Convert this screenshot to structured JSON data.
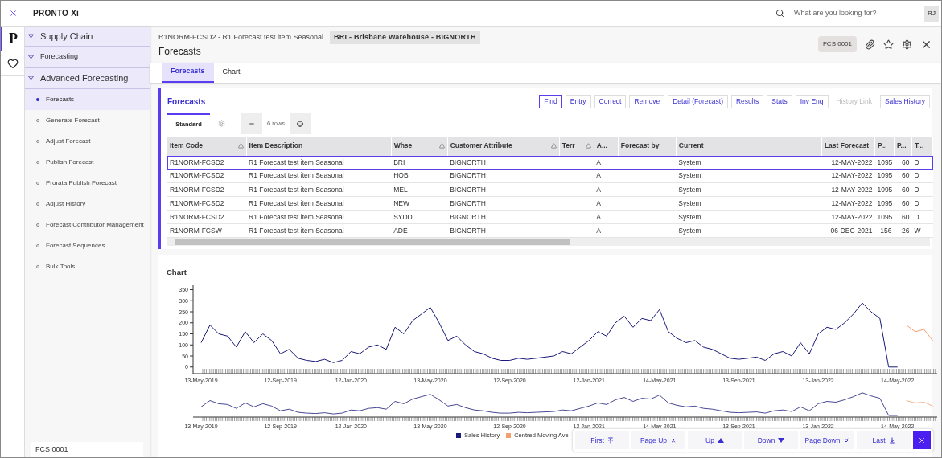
{
  "topbar": {
    "logo": "PRONTO Xi",
    "search": {
      "placeholder": "What are you looking for?"
    },
    "avatar": "RJ"
  },
  "rail": {
    "logo": "P"
  },
  "sidebar": {
    "tree": [
      {
        "label": "Supply Chain",
        "expanded": true,
        "children": [
          {
            "label": "Forecasting",
            "expanded": true,
            "children": [
              {
                "label": "Advanced Forecasting",
                "expanded": true,
                "children": [
                  {
                    "label": "Forecasts",
                    "selected": true
                  },
                  {
                    "label": "Generate Forecast",
                    "selected": false
                  },
                  {
                    "label": "Adjust Forecast",
                    "selected": false
                  },
                  {
                    "label": "Publish Forecast",
                    "selected": false
                  },
                  {
                    "label": "Prorata Publish Forecast",
                    "selected": false
                  },
                  {
                    "label": "Adjust History",
                    "selected": false
                  },
                  {
                    "label": "Forecast Contributor Management",
                    "selected": false
                  },
                  {
                    "label": "Forecast Sequences",
                    "selected": false
                  },
                  {
                    "label": "Bulk Tools",
                    "selected": false
                  }
                ]
              }
            ]
          }
        ]
      }
    ],
    "footer": "FCS 0001"
  },
  "header": {
    "breadcrumb": "R1NORM-FCSD2 - R1 Forecast test item Seasonal",
    "badge": "BRI - Brisbane Warehouse - BIGNORTH",
    "title": "Forecasts",
    "code": "FCS 0001"
  },
  "tabs": [
    {
      "label": "Forecasts",
      "selected": true
    },
    {
      "label": "Chart",
      "selected": false
    }
  ],
  "forecasts": {
    "title": "Forecasts",
    "actions": [
      {
        "label": "Find",
        "focused": true,
        "disabled": false
      },
      {
        "label": "Entry",
        "focused": false,
        "disabled": false
      },
      {
        "label": "Correct",
        "focused": false,
        "disabled": false
      },
      {
        "label": "Remove",
        "focused": false,
        "disabled": false
      },
      {
        "label": "Detail (Forecast)",
        "focused": false,
        "disabled": false
      },
      {
        "label": "Results",
        "focused": false,
        "disabled": false
      },
      {
        "label": "Stats",
        "focused": false,
        "disabled": false
      },
      {
        "label": "Inv Enq",
        "focused": false,
        "disabled": false
      },
      {
        "label": "History Link",
        "focused": false,
        "disabled": true
      },
      {
        "label": "Sales History",
        "focused": false,
        "disabled": false
      }
    ],
    "view": "Standard",
    "row_count": "6 rows",
    "columns": [
      {
        "label": "Item Code",
        "sortable": true
      },
      {
        "label": "Item Description",
        "sortable": false
      },
      {
        "label": "Whse",
        "sortable": true
      },
      {
        "label": "Customer Attribute",
        "sortable": true
      },
      {
        "label": "Terr",
        "sortable": true
      },
      {
        "label": "A...",
        "sortable": false
      },
      {
        "label": "Forecast by",
        "sortable": false
      },
      {
        "label": "Current",
        "sortable": false
      },
      {
        "label": "Last Forecast",
        "sortable": false
      },
      {
        "label": "P...",
        "sortable": false
      },
      {
        "label": "P...",
        "sortable": false
      },
      {
        "label": "T...",
        "sortable": false
      }
    ],
    "rows": [
      {
        "selected": true,
        "cells": [
          "R1NORM-FCSD2",
          "R1 Forecast test item Seasonal",
          "BRI",
          "BIGNORTH",
          "",
          "A",
          "",
          "System",
          "12-MAY-2022",
          "1095",
          "60",
          "D"
        ]
      },
      {
        "selected": false,
        "cells": [
          "R1NORM-FCSD2",
          "R1 Forecast test item Seasonal",
          "HOB",
          "BIGNORTH",
          "",
          "A",
          "",
          "System",
          "12-MAY-2022",
          "1095",
          "60",
          "D"
        ]
      },
      {
        "selected": false,
        "cells": [
          "R1NORM-FCSD2",
          "R1 Forecast test item Seasonal",
          "MEL",
          "BIGNORTH",
          "",
          "A",
          "",
          "System",
          "12-MAY-2022",
          "1095",
          "60",
          "D"
        ]
      },
      {
        "selected": false,
        "cells": [
          "R1NORM-FCSD2",
          "R1 Forecast test item Seasonal",
          "NEW",
          "BIGNORTH",
          "",
          "A",
          "",
          "System",
          "12-MAY-2022",
          "1095",
          "60",
          "D"
        ]
      },
      {
        "selected": false,
        "cells": [
          "R1NORM-FCSD2",
          "R1 Forecast test item Seasonal",
          "SYDD",
          "BIGNORTH",
          "",
          "A",
          "",
          "System",
          "12-MAY-2022",
          "1095",
          "60",
          "D"
        ]
      },
      {
        "selected": false,
        "cells": [
          "R1NORM-FCSW",
          "R1 Forecast test item Seasonal",
          "ADE",
          "BIGNORTH",
          "",
          "A",
          "",
          "System",
          "06-DEC-2021",
          "156",
          "26",
          "W"
        ]
      }
    ]
  },
  "chart": {
    "title": "Chart",
    "chart_data": {
      "type": "line",
      "ylim": [
        -30,
        370
      ],
      "legend": true,
      "yticks": [
        0,
        50,
        100,
        150,
        200,
        250,
        300,
        350
      ],
      "categories": [
        "13-May-2019",
        null,
        null,
        null,
        null,
        null,
        null,
        null,
        null,
        "12-Sep-2019",
        null,
        null,
        null,
        null,
        null,
        null,
        null,
        "12-Jan-2020",
        null,
        null,
        null,
        null,
        null,
        null,
        null,
        null,
        "13-May-2020",
        null,
        null,
        null,
        null,
        null,
        null,
        null,
        null,
        "12-Sep-2020",
        null,
        null,
        null,
        null,
        null,
        null,
        null,
        null,
        "12-Jan-2021",
        null,
        null,
        null,
        null,
        null,
        null,
        null,
        "14-May-2021",
        null,
        null,
        null,
        null,
        null,
        null,
        null,
        null,
        "13-Sep-2021",
        null,
        null,
        null,
        null,
        null,
        null,
        null,
        null,
        "13-Jan-2022",
        null,
        null,
        null,
        null,
        null,
        null,
        null,
        null,
        "14-May-2022",
        null,
        null,
        null,
        null
      ],
      "series": [
        {
          "name": "Sales History",
          "color": "#1a1a7a",
          "values": [
            110,
            190,
            150,
            140,
            90,
            160,
            110,
            150,
            120,
            60,
            80,
            40,
            30,
            25,
            35,
            20,
            30,
            70,
            60,
            90,
            100,
            80,
            180,
            150,
            210,
            240,
            270,
            200,
            120,
            140,
            100,
            70,
            60,
            40,
            30,
            30,
            40,
            35,
            40,
            45,
            50,
            70,
            60,
            90,
            120,
            160,
            140,
            200,
            230,
            180,
            220,
            210,
            260,
            160,
            130,
            110,
            120,
            90,
            80,
            60,
            40,
            35,
            40,
            45,
            30,
            60,
            70,
            50,
            110,
            60,
            150,
            180,
            170,
            200,
            240,
            290,
            250,
            220,
            0,
            0,
            null,
            null,
            null,
            null
          ]
        },
        {
          "name": "Centred Moving Ave",
          "color": "#f4a070",
          "values": [
            null,
            null,
            null,
            null,
            null,
            null,
            null,
            null,
            null,
            null,
            null,
            null,
            null,
            null,
            null,
            null,
            null,
            null,
            null,
            null,
            null,
            null,
            null,
            null,
            null,
            null,
            null,
            null,
            null,
            null,
            null,
            null,
            null,
            null,
            null,
            null,
            null,
            null,
            null,
            null,
            null,
            null,
            null,
            null,
            null,
            null,
            null,
            null,
            null,
            null,
            null,
            null,
            null,
            null,
            null,
            null,
            null,
            null,
            null,
            null,
            null,
            null,
            null,
            null,
            null,
            null,
            null,
            null,
            null,
            null,
            null,
            null,
            null,
            null,
            null,
            null,
            null,
            null,
            null,
            null,
            190,
            160,
            170,
            120
          ]
        }
      ]
    },
    "navigator_ticks": [
      "13-May-2019",
      "12-Sep-2019",
      "12-Jan-2020",
      "13-May-2020",
      "12-Sep-2020",
      "12-Jan-2021",
      "14-May-2021",
      "13-Sep-2021",
      "13-Jan-2022",
      "14-May-2022"
    ]
  },
  "nav": [
    "First",
    "Page Up",
    "Up",
    "Down",
    "Page Down",
    "Last"
  ]
}
